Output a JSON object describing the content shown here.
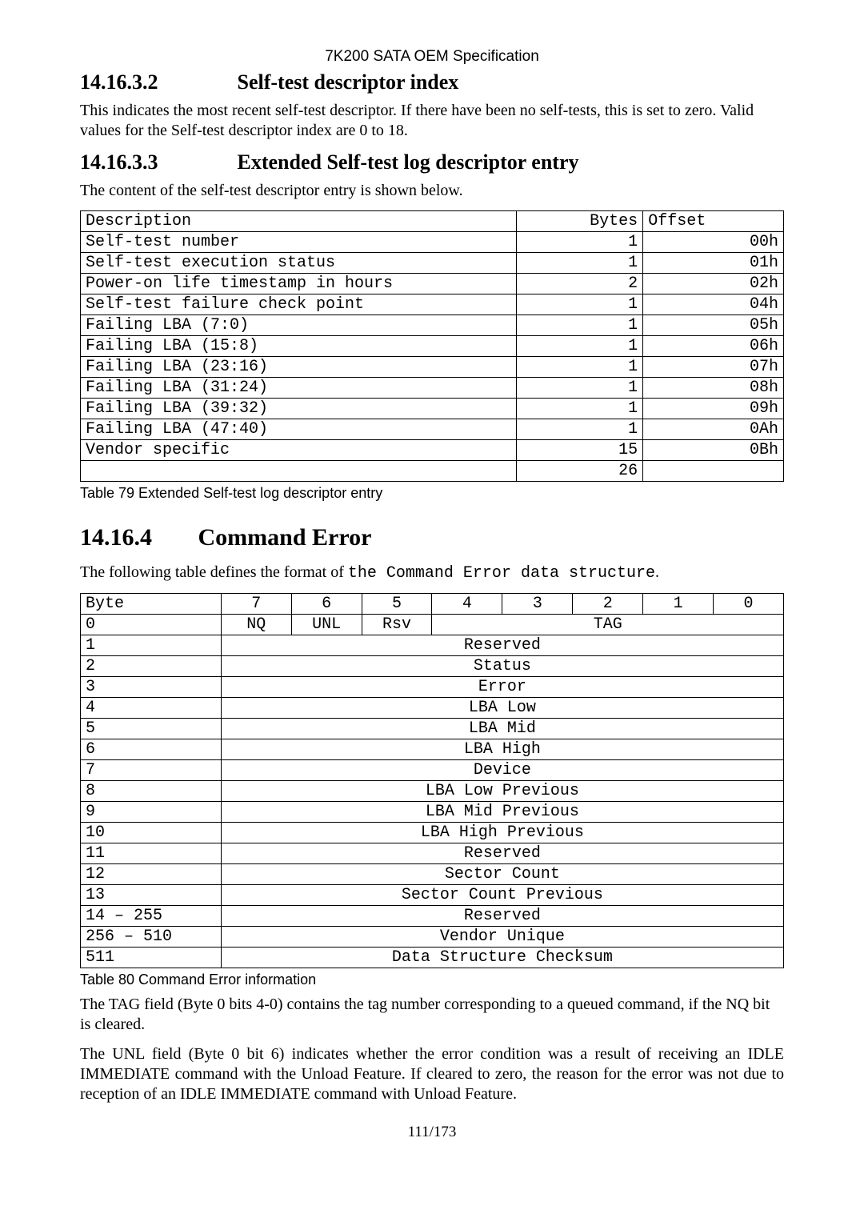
{
  "doc_header": "7K200 SATA OEM Specification",
  "sec_a": {
    "num": "14.16.3.2",
    "title": "Self-test descriptor index",
    "para": "This indicates the most recent self-test descriptor. If there have been no self-tests, this is set to zero. Valid values for the Self-test descriptor index are 0 to 18."
  },
  "sec_b": {
    "num": "14.16.3.3",
    "title": "Extended Self-test log descriptor entry",
    "para": "The content of the self-test descriptor entry is shown below."
  },
  "table1": {
    "headers": {
      "c0": "Description",
      "c1": "Bytes",
      "c2": "Offset"
    },
    "rows": [
      {
        "c0": "Self-test number",
        "c1": "1",
        "c2": "00h"
      },
      {
        "c0": "Self-test execution status",
        "c1": "1",
        "c2": "01h"
      },
      {
        "c0": "Power-on life timestamp in hours",
        "c1": "2",
        "c2": "02h"
      },
      {
        "c0": "Self-test failure check point",
        "c1": "1",
        "c2": "04h"
      },
      {
        "c0": "Failing LBA (7:0)",
        "c1": "1",
        "c2": "05h"
      },
      {
        "c0": "Failing LBA (15:8)",
        "c1": "1",
        "c2": "06h"
      },
      {
        "c0": "Failing LBA (23:16)",
        "c1": "1",
        "c2": "07h"
      },
      {
        "c0": "Failing LBA (31:24)",
        "c1": "1",
        "c2": "08h"
      },
      {
        "c0": "Failing LBA (39:32)",
        "c1": "1",
        "c2": "09h"
      },
      {
        "c0": "Failing LBA (47:40)",
        "c1": "1",
        "c2": "0Ah"
      },
      {
        "c0": "Vendor specific",
        "c1": "15",
        "c2": "0Bh"
      },
      {
        "c0": "",
        "c1": "26",
        "c2": ""
      }
    ]
  },
  "table1_caption": "Table 79 Extended Self-test log descriptor entry",
  "sec_c": {
    "num": "14.16.4",
    "title": "Command Error",
    "para_prefix": "The following table defines the format of ",
    "para_mono": "the Command Error data structure",
    "para_suffix": "."
  },
  "table2": {
    "headers": {
      "byte": "Byte",
      "b7": "7",
      "b6": "6",
      "b5": "5",
      "b4": "4",
      "b3": "3",
      "b2": "2",
      "b1": "1",
      "b0": "0"
    },
    "row0": {
      "byte": "0",
      "nq": "NQ",
      "unl": "UNL",
      "rsv": "Rsv",
      "tag": "TAG"
    },
    "rows": [
      {
        "byte": "1",
        "val": "Reserved"
      },
      {
        "byte": "2",
        "val": "Status"
      },
      {
        "byte": "3",
        "val": "Error"
      },
      {
        "byte": "4",
        "val": "LBA Low"
      },
      {
        "byte": "5",
        "val": "LBA Mid"
      },
      {
        "byte": "6",
        "val": "LBA High"
      },
      {
        "byte": "7",
        "val": "Device"
      },
      {
        "byte": "8",
        "val": "LBA Low Previous"
      },
      {
        "byte": "9",
        "val": "LBA Mid Previous"
      },
      {
        "byte": "10",
        "val": "LBA High Previous"
      },
      {
        "byte": "11",
        "val": "Reserved"
      },
      {
        "byte": "12",
        "val": "Sector Count"
      },
      {
        "byte": "13",
        "val": "Sector Count Previous"
      },
      {
        "byte": "14 – 255",
        "val": "Reserved"
      },
      {
        "byte": "256 – 510",
        "val": "Vendor Unique"
      },
      {
        "byte": "511",
        "val": "Data Structure Checksum"
      }
    ]
  },
  "table2_caption": "Table 80 Command Error information",
  "para_tag": "The TAG field (Byte 0 bits 4-0) contains the tag number corresponding to a queued command, if the NQ bit is cleared.",
  "para_unl": "The UNL field (Byte 0 bit 6) indicates whether the error condition was a result of receiving an IDLE IMMEDIATE command with the Unload Feature.   If cleared to zero, the reason for the error was not due to reception of an IDLE IMMEDIATE command with Unload Feature.",
  "page_num": "111/173"
}
